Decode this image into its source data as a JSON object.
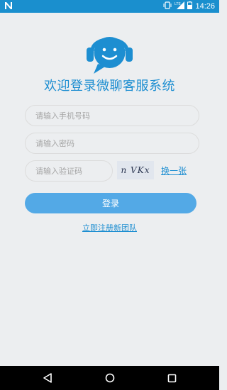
{
  "status_bar": {
    "time": "14:26",
    "network_label": "LTE"
  },
  "login": {
    "title": "欢迎登录微聊客服系统",
    "phone_placeholder": "请输入手机号码",
    "password_placeholder": "请输入密码",
    "captcha_placeholder": "请输入验证码",
    "captcha_text": "n VKx",
    "refresh_label": "换一张",
    "login_label": "登录",
    "register_label": "立即注册新团队"
  },
  "colors": {
    "status_bar": "#1a8fce",
    "accent": "#1d8ed1",
    "button": "#53a9e6",
    "background": "#eceef0"
  },
  "icons": {
    "logo": "smiling-chat-headset-icon",
    "notification": "n-icon",
    "vibrate": "vibrate-icon",
    "signal": "signal-icon",
    "battery": "battery-icon",
    "back": "back-icon",
    "home": "home-icon",
    "recents": "recents-icon"
  }
}
